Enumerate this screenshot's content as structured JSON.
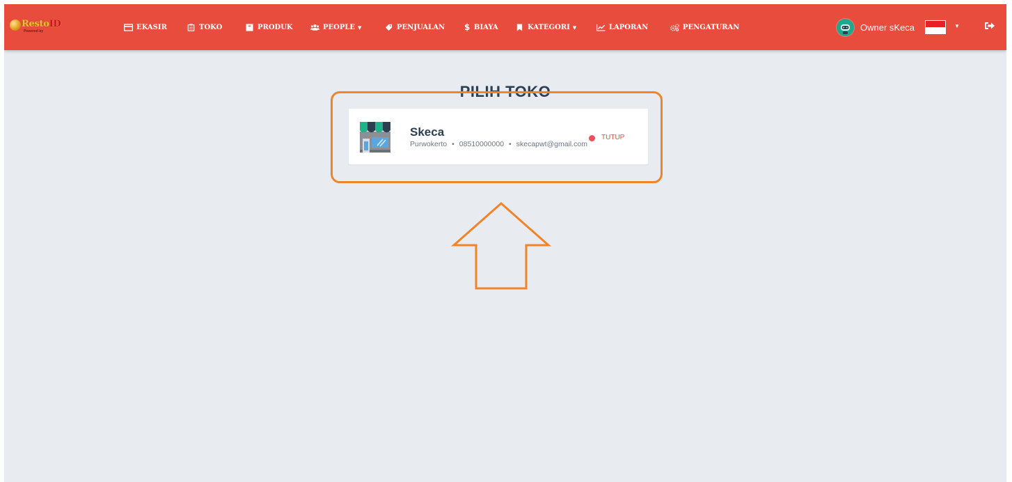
{
  "app": {
    "logo_word": "Resto",
    "logo_suffix": "ID",
    "logo_tagline": "Powered by"
  },
  "navbar": {
    "items": [
      {
        "label": "EKASIR",
        "icon": "credit-card-icon"
      },
      {
        "label": "TOKO",
        "icon": "store-icon"
      },
      {
        "label": "PRODUK",
        "icon": "box-icon"
      },
      {
        "label": "PEOPLE",
        "icon": "users-icon",
        "has_dropdown": true
      },
      {
        "label": "PENJUALAN",
        "icon": "tag-icon"
      },
      {
        "label": "BIAYA",
        "icon": "dollar-icon"
      },
      {
        "label": "KATEGORI",
        "icon": "bookmark-icon",
        "has_dropdown": true
      },
      {
        "label": "LAPORAN",
        "icon": "line-chart-icon"
      },
      {
        "label": "PENGATURAN",
        "icon": "cogs-icon"
      }
    ],
    "caret": "▼",
    "user_name": "Owner sKeca",
    "language_flag": "indonesia-flag"
  },
  "main": {
    "title": "PILIH TOKO",
    "stores": [
      {
        "name": "Skeca",
        "city": "Purwokerto",
        "phone": "08510000000",
        "email": "skecapwt@gmail.com",
        "status": "TUTUP",
        "status_color": "#ef4e60"
      }
    ]
  },
  "colors": {
    "navbar_bg": "#e84c3d",
    "page_bg": "#e8ecf0",
    "annotation": "#f28327"
  }
}
